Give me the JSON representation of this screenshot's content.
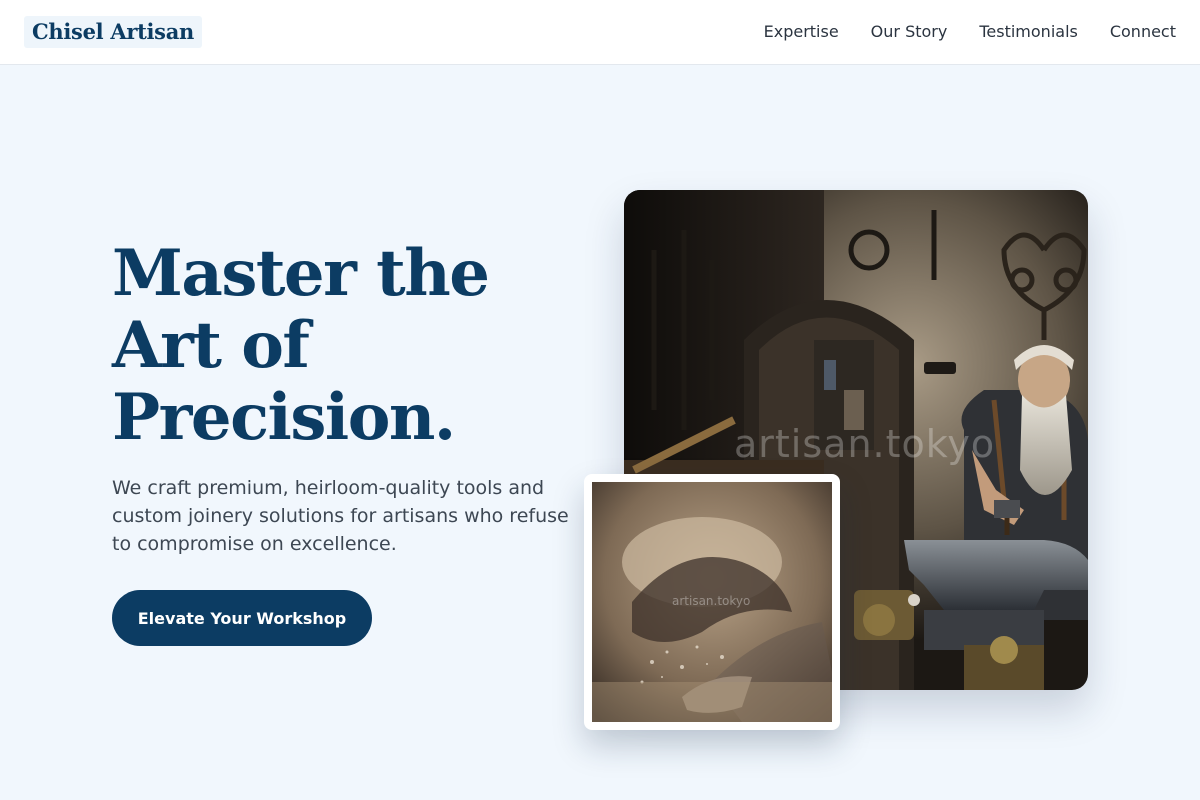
{
  "header": {
    "logo": "Chisel Artisan",
    "nav": [
      "Expertise",
      "Our Story",
      "Testimonials",
      "Connect"
    ]
  },
  "hero": {
    "title_lines": [
      "Master the",
      "Art of",
      "Precision."
    ],
    "subtitle": "We craft premium, heirloom-quality tools and custom joinery solutions for artisans who refuse to compromise on excellence.",
    "cta": "Elevate Your Workshop"
  },
  "images": {
    "main_watermark": "artisan.tokyo",
    "inset_watermark": "artisan.tokyo"
  },
  "colors": {
    "brand_navy": "#0c3c63",
    "page_background": "#f1f7fd",
    "header_background": "#ffffff"
  }
}
